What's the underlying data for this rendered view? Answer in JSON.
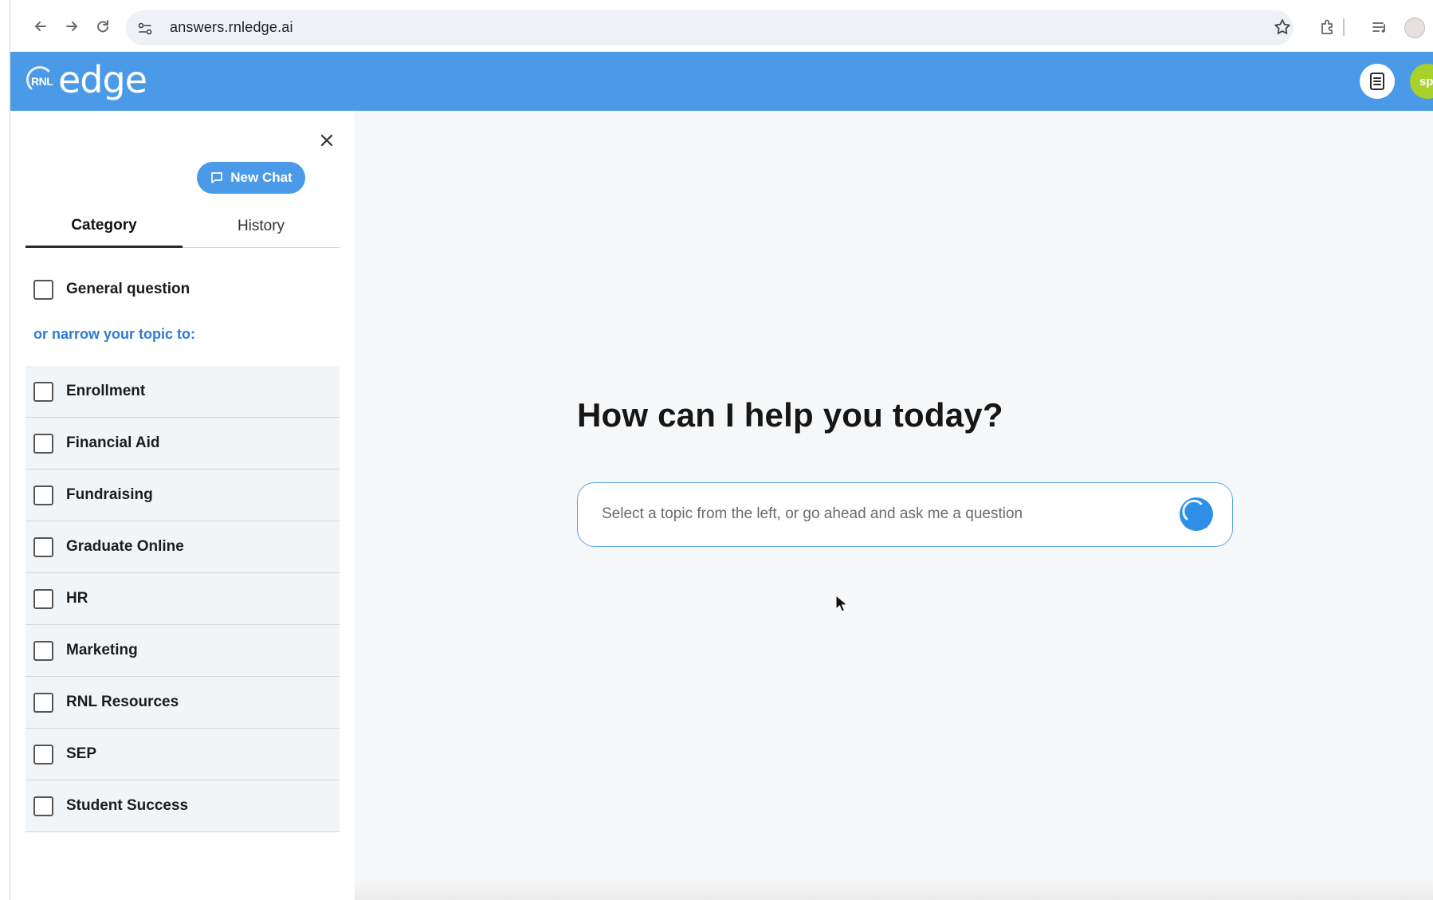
{
  "browser": {
    "url": "answers.rnledge.ai"
  },
  "header": {
    "logo_mark": "RNL",
    "logo_word": "edge",
    "avatar_initials": "sp",
    "brand_color": "#4a9ae8",
    "avatar_color": "#a8d12c"
  },
  "sidebar": {
    "new_chat_label": "New Chat",
    "tabs": [
      {
        "label": "Category"
      },
      {
        "label": "History"
      }
    ],
    "general_question_label": "General question",
    "narrow_label": "or narrow your topic to:",
    "topics": [
      {
        "label": "Enrollment"
      },
      {
        "label": "Financial Aid"
      },
      {
        "label": "Fundraising"
      },
      {
        "label": "Graduate Online"
      },
      {
        "label": "HR"
      },
      {
        "label": "Marketing"
      },
      {
        "label": "RNL Resources"
      },
      {
        "label": "SEP"
      },
      {
        "label": "Student Success"
      }
    ]
  },
  "main": {
    "headline": "How can I help you today?",
    "input_placeholder": "Select a topic from the left, or go ahead and ask me a question"
  }
}
